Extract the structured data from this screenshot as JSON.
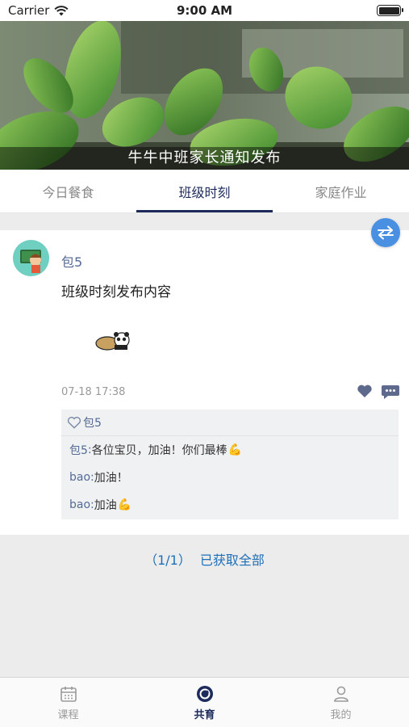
{
  "status_bar": {
    "carrier": "Carrier",
    "time": "9:00 AM"
  },
  "banner": {
    "caption": "牛牛中班家长通知发布"
  },
  "tabs": [
    {
      "label": "今日餐食",
      "active": false
    },
    {
      "label": "班级时刻",
      "active": true
    },
    {
      "label": "家庭作业",
      "active": false
    }
  ],
  "post": {
    "author": "包5",
    "content": "班级时刻发布内容",
    "timestamp": "07-18 17:38",
    "likes_label": "包5",
    "comments": [
      {
        "author": "包5",
        "separator": ": ",
        "text": "各位宝贝，加油！你们最棒",
        "emoji": "💪"
      },
      {
        "author": "bao",
        "separator": ": ",
        "text": "加油！",
        "emoji": ""
      },
      {
        "author": "bao",
        "separator": ": ",
        "text": "加油",
        "emoji": "💪"
      }
    ]
  },
  "load_status": "（1/1） 已获取全部",
  "tabbar": [
    {
      "label": "课程",
      "icon": "calendar-icon",
      "active": false
    },
    {
      "label": "共育",
      "icon": "cogrowth-icon",
      "active": true
    },
    {
      "label": "我的",
      "icon": "person-icon",
      "active": false
    }
  ],
  "colors": {
    "accent": "#1d2b5c",
    "link": "#556a96",
    "switch_button": "#4a90e2",
    "load_status": "#1e6fb8"
  }
}
